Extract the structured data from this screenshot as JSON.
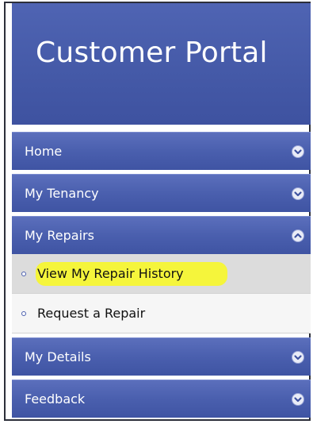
{
  "header": {
    "title": "Customer Portal"
  },
  "menu": {
    "items": [
      {
        "label": "Home",
        "expanded": false
      },
      {
        "label": "My Tenancy",
        "expanded": false
      },
      {
        "label": "My Repairs",
        "expanded": true
      },
      {
        "label": "My Details",
        "expanded": false
      },
      {
        "label": "Feedback",
        "expanded": false
      }
    ],
    "repairs_submenu": [
      {
        "label": "View My Repair History",
        "highlighted": true
      },
      {
        "label": "Request a Repair",
        "highlighted": false
      }
    ]
  },
  "colors": {
    "header_bg": "#4a5fae",
    "menu_bg": "#4a5fae",
    "highlight": "#f5f531"
  }
}
